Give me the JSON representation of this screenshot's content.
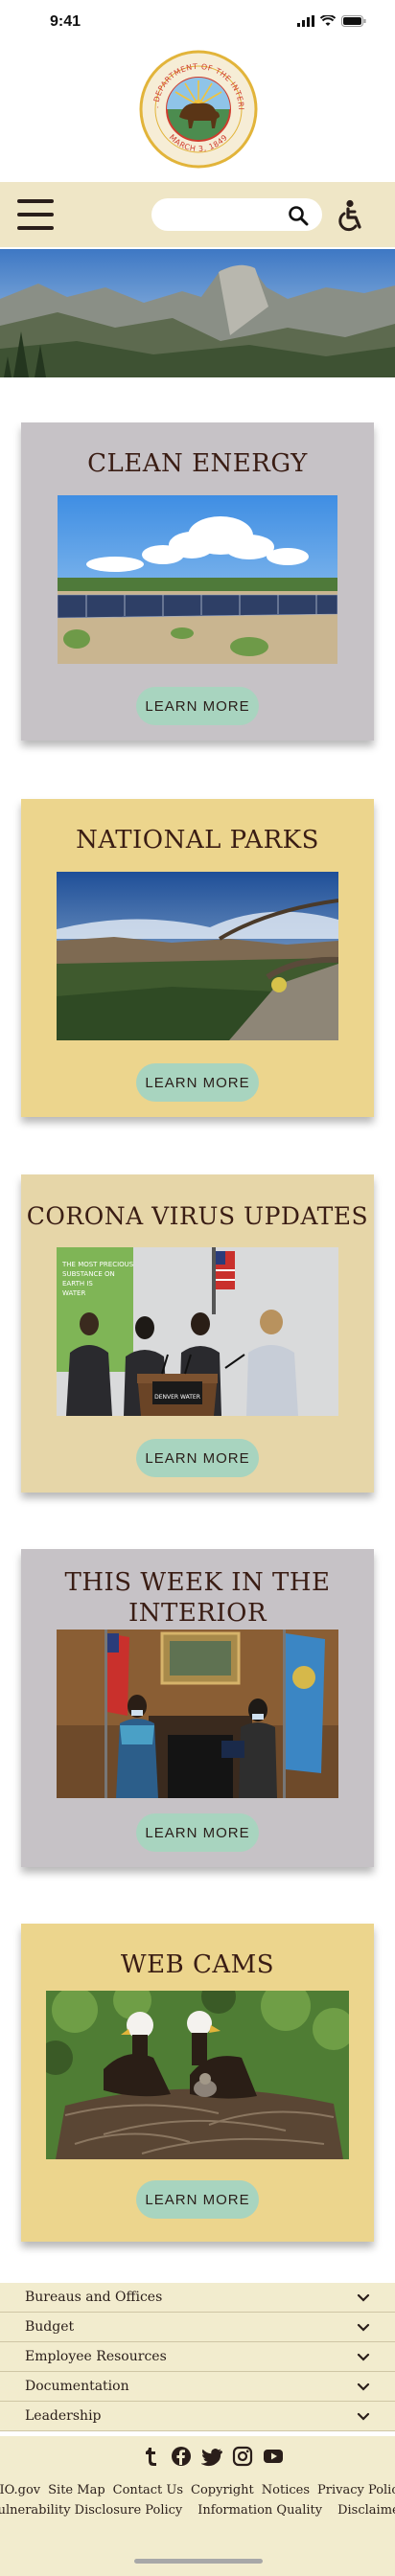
{
  "status": {
    "time": "9:41"
  },
  "seal": {
    "top_text": "U.S. DEPARTMENT OF THE INTERIOR",
    "bottom_text": "MARCH 3, 1849"
  },
  "nav": {
    "search_placeholder": "",
    "menu_icon": "hamburger-icon",
    "search_icon": "magnifier-icon",
    "accessibility_icon": "wheelchair-icon"
  },
  "colors": {
    "nav_bg": "#efe6c6",
    "card_gray": "#c6c2c6",
    "card_yellow": "#ecd58d",
    "card_tan": "#e6d6a8",
    "button": "#a8d4bf",
    "footer_bg": "#f2ecce",
    "title_text": "#3a1d14"
  },
  "cards": [
    {
      "title": "CLEAN ENERGY",
      "button": "LEARN  MORE"
    },
    {
      "title": "NATIONAL PARKS",
      "button": "LEARN  MORE"
    },
    {
      "title": "CORONA VIRUS UPDATES",
      "button": "LEARN  MORE",
      "photo_text": [
        "THE MOST PRECIOUS",
        "SUBSTANCE ON",
        "EARTH IS",
        "WATER"
      ],
      "podium_text": "DENVER WATER"
    },
    {
      "title_line1": "THIS WEEK IN THE",
      "title_line2": "INTERIOR",
      "button": "LEARN  MORE"
    },
    {
      "title": "WEB CAMS",
      "button": "LEARN  MORE"
    }
  ],
  "accordion": [
    "Bureaus and Offices",
    "Budget",
    "Employee Resources",
    "Documentation",
    "Leadership"
  ],
  "footer": {
    "social_icons": [
      "tumblr-icon",
      "facebook-icon",
      "twitter-icon",
      "instagram-icon",
      "youtube-icon"
    ],
    "links_row1": [
      "DIO.gov",
      "Site Map",
      "Contact Us",
      "Copyright",
      "Notices",
      "Privacy Policy"
    ],
    "links_row2": [
      "Vulnerability Disclosure Policy",
      "Information Quality",
      "Disclaimer"
    ]
  }
}
